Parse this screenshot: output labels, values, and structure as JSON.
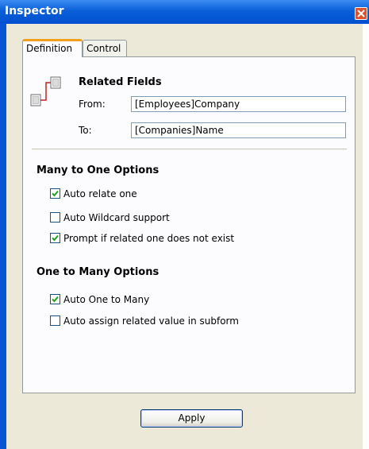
{
  "window": {
    "title": "Inspector"
  },
  "tabs": [
    {
      "label": "Definition",
      "active": true
    },
    {
      "label": "Control",
      "active": false
    }
  ],
  "related_fields": {
    "heading": "Related Fields",
    "from_label": "From:",
    "from_value": "[Employees]Company",
    "to_label": "To:",
    "to_value": "[Companies]Name"
  },
  "many_to_one": {
    "heading": "Many to One Options",
    "options": [
      {
        "label": "Auto relate one",
        "checked": true
      },
      {
        "label": "Auto Wildcard support",
        "checked": false
      },
      {
        "label": "Prompt if related one does not exist",
        "checked": true
      }
    ]
  },
  "one_to_many": {
    "heading": "One to Many Options",
    "options": [
      {
        "label": "Auto One to Many",
        "checked": true
      },
      {
        "label": "Auto assign related value in subform",
        "checked": false
      }
    ]
  },
  "apply_label": "Apply",
  "colors": {
    "titlebar": "#0a5fd8",
    "panel": "#fcfcfe",
    "window": "#ece9d8",
    "check": "#21a121"
  }
}
